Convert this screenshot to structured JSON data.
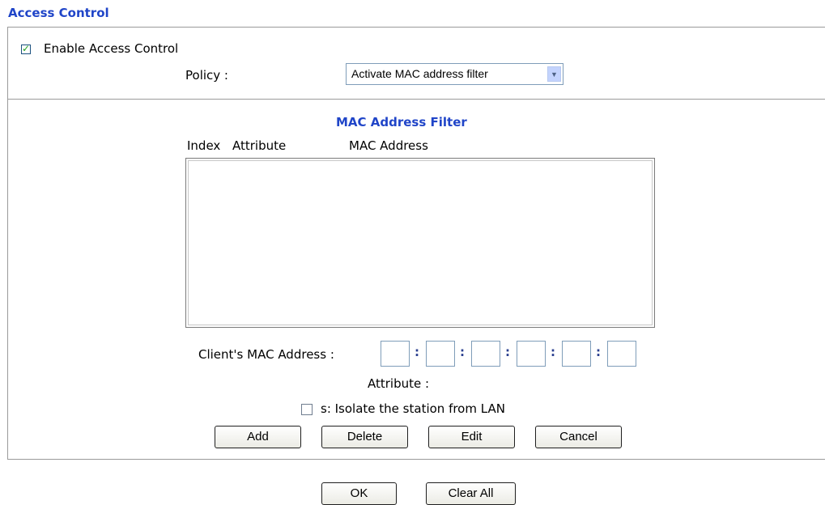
{
  "page": {
    "title": "Access Control"
  },
  "form": {
    "enable_label": "Enable Access Control",
    "enable_checked": true,
    "policy_label": "Policy :",
    "policy_value": "Activate MAC address filter"
  },
  "mac_filter": {
    "title": "MAC Address Filter",
    "columns": [
      "Index",
      "Attribute",
      "MAC Address"
    ],
    "rows": [],
    "client_mac_label": "Client's MAC Address :",
    "mac_separator": ":",
    "attribute_label": "Attribute :",
    "isolate_label": "s: Isolate the station from LAN",
    "isolate_checked": false
  },
  "buttons": {
    "add": "Add",
    "delete": "Delete",
    "edit": "Edit",
    "cancel": "Cancel",
    "ok": "OK",
    "clear_all": "Clear All"
  }
}
